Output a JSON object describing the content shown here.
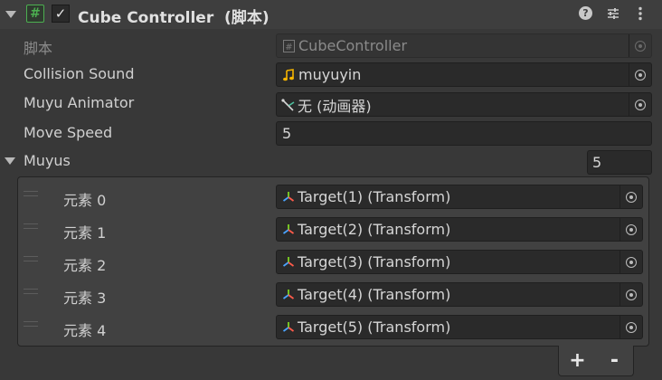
{
  "component": {
    "title": "Cube Controller  (脚本)",
    "enabled_check": "✓",
    "script_icon": "#",
    "header_icons": [
      "help-icon",
      "presets-icon",
      "more-icon"
    ]
  },
  "fields": {
    "script": {
      "label": "脚本",
      "value": "CubeController",
      "icon": "script-icon"
    },
    "collision_sound": {
      "label": "Collision Sound",
      "value": "muyuyin",
      "icon": "audio-clip-icon"
    },
    "muyu_animator": {
      "label": "Muyu Animator",
      "value": "无 (动画器)",
      "icon": "animator-icon"
    },
    "move_speed": {
      "label": "Move Speed",
      "value": "5"
    }
  },
  "muyus": {
    "label": "Muyus",
    "size": "5",
    "elements": [
      {
        "label": "元素 0",
        "value": "Target(1) (Transform)"
      },
      {
        "label": "元素 1",
        "value": "Target(2) (Transform)"
      },
      {
        "label": "元素 2",
        "value": "Target(3) (Transform)"
      },
      {
        "label": "元素 3",
        "value": "Target(4) (Transform)"
      },
      {
        "label": "元素 4",
        "value": "Target(5) (Transform)"
      }
    ],
    "add_label": "+",
    "remove_label": "-"
  },
  "colors": {
    "background": "#383838",
    "field_bg": "#2a2a2a",
    "script_green": "#4caf50",
    "audio_yellow": "#f5b400"
  }
}
